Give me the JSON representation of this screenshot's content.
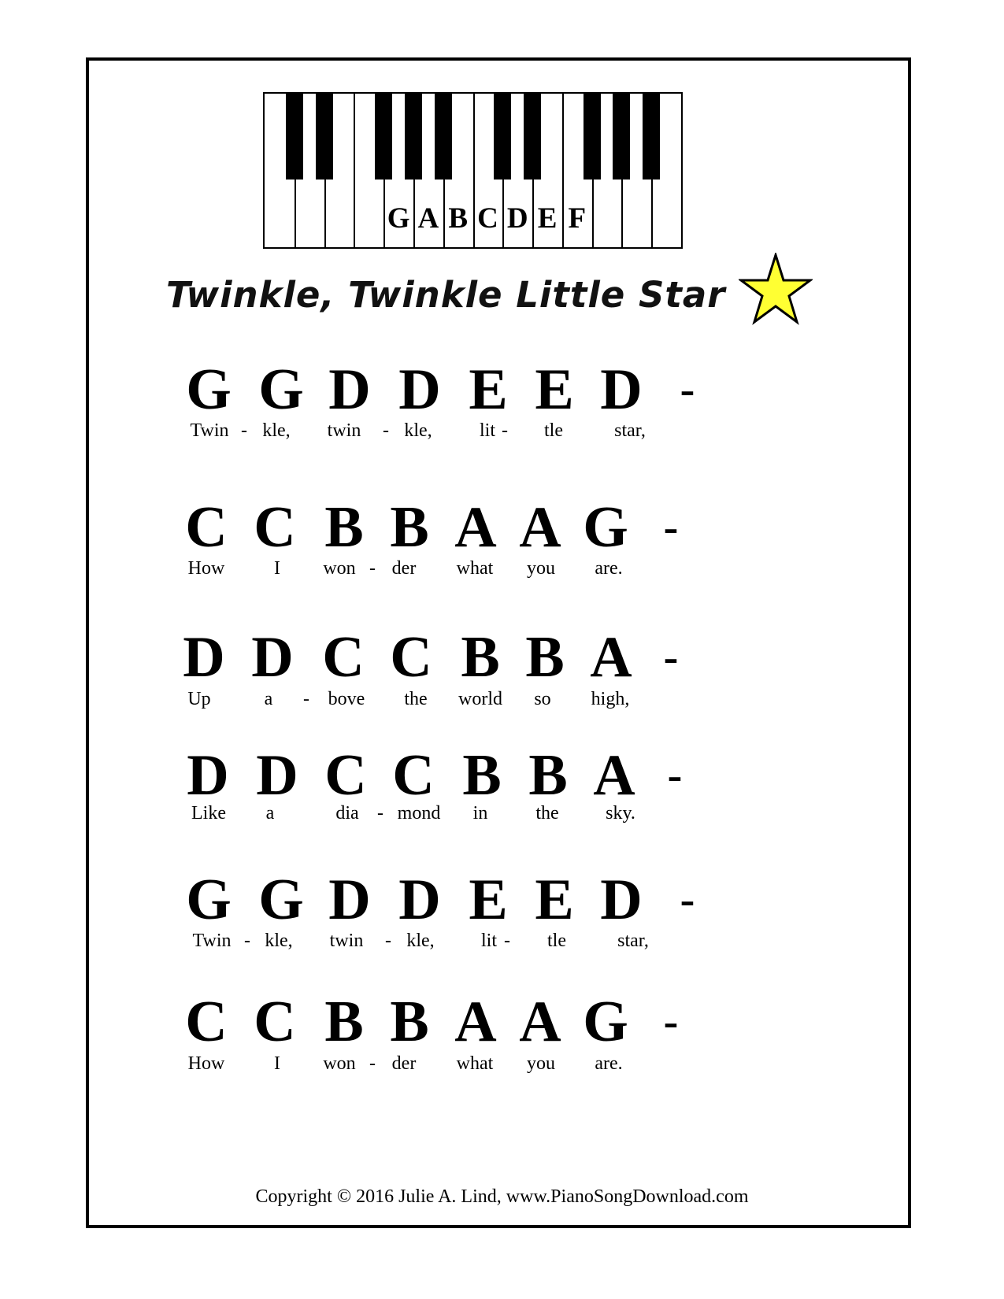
{
  "keyboard_labels": [
    "G",
    "A",
    "B",
    "C",
    "D",
    "E",
    "F"
  ],
  "title": "Twinkle, Twinkle Little Star",
  "star_icon": "star-icon",
  "star_color": "#ffff33",
  "lines": [
    {
      "notes": [
        "G",
        "G",
        "D",
        "D",
        "E",
        "E",
        "D",
        "-"
      ],
      "lyrics": [
        "Twin",
        "-",
        "kle,",
        "twin",
        "-",
        "kle,",
        "lit",
        "-",
        "tle",
        "star,"
      ]
    },
    {
      "notes": [
        "C",
        "C",
        "B",
        "B",
        "A",
        "A",
        "G",
        "-"
      ],
      "lyrics": [
        "How",
        "I",
        "won",
        "-",
        "der",
        "what",
        "you",
        "are."
      ]
    },
    {
      "notes": [
        "D",
        "D",
        "C",
        "C",
        "B",
        "B",
        "A",
        "-"
      ],
      "lyrics": [
        "Up",
        "a",
        "-",
        "bove",
        "the",
        "world",
        "so",
        "high,"
      ]
    },
    {
      "notes": [
        "D",
        "D",
        "C",
        "C",
        "B",
        "B",
        "A",
        "-"
      ],
      "lyrics": [
        "Like",
        "a",
        "dia",
        "-",
        "mond",
        "in",
        "the",
        "sky."
      ]
    },
    {
      "notes": [
        "G",
        "G",
        "D",
        "D",
        "E",
        "E",
        "D",
        "-"
      ],
      "lyrics": [
        "Twin",
        "-",
        "kle,",
        "twin",
        "-",
        "kle,",
        "lit",
        "-",
        "tle",
        "star,"
      ]
    },
    {
      "notes": [
        "C",
        "C",
        "B",
        "B",
        "A",
        "A",
        "G",
        "-"
      ],
      "lyrics": [
        "How",
        "I",
        "won",
        "-",
        "der",
        "what",
        "you",
        "are."
      ]
    }
  ],
  "footer": "Copyright © 2016 Julie A. Lind, www.PianoSongDownload.com"
}
